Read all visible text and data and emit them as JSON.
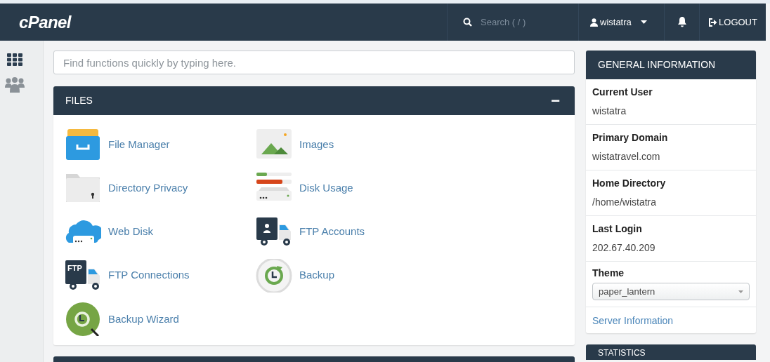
{
  "header": {
    "logo": "cPanel",
    "search": {
      "placeholder": "Search ( / )"
    },
    "user": "wistatra",
    "logout": "LOGOUT"
  },
  "quick_search": {
    "placeholder": "Find functions quickly by typing here."
  },
  "files": {
    "title": "FILES",
    "toggle": "−",
    "items": [
      {
        "label": "File Manager"
      },
      {
        "label": "Images"
      },
      {
        "label": "Directory Privacy"
      },
      {
        "label": "Disk Usage"
      },
      {
        "label": "Web Disk"
      },
      {
        "label": "FTP Accounts"
      },
      {
        "label": "FTP Connections",
        "icon_text": "FTP"
      },
      {
        "label": "Backup"
      },
      {
        "label": "Backup Wizard"
      }
    ]
  },
  "general_information": {
    "title": "GENERAL INFORMATION",
    "fields": [
      {
        "label": "Current User",
        "value": "wistatra"
      },
      {
        "label": "Primary Domain",
        "value": "wistatravel.com"
      },
      {
        "label": "Home Directory",
        "value": "/home/wistatra"
      },
      {
        "label": "Last Login",
        "value": "202.67.40.209"
      }
    ],
    "theme": {
      "label": "Theme",
      "value": "paper_lantern"
    },
    "link": "Server Information"
  },
  "statistics": {
    "title": "STATISTICS"
  }
}
